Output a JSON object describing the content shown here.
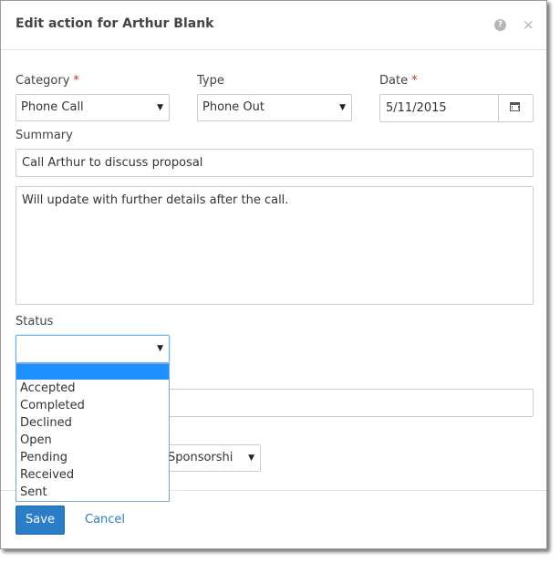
{
  "dialog": {
    "title": "Edit action for Arthur Blank",
    "help_icon_glyph": "?",
    "close_icon_glyph": "×"
  },
  "form": {
    "category": {
      "label": "Category",
      "required_mark": "*",
      "value": "Phone Call"
    },
    "type": {
      "label": "Type",
      "value": "Phone Out"
    },
    "date": {
      "label": "Date",
      "required_mark": "*",
      "value": "5/11/2015",
      "icon": "calendar-icon"
    },
    "summary": {
      "label": "Summary",
      "value": "Call Arthur to discuss proposal"
    },
    "notes": {
      "value": "Will update with further details after the call."
    },
    "status": {
      "label": "Status",
      "value": "",
      "options": [
        "",
        "Accepted",
        "Completed",
        "Declined",
        "Open",
        "Pending",
        "Received",
        "Sent"
      ],
      "highlighted_index": 0
    },
    "hidden_select": {
      "partial_value": "Sponsorshi"
    }
  },
  "footer": {
    "save_label": "Save",
    "cancel_label": "Cancel"
  },
  "colors": {
    "primary": "#2a7dc6",
    "required": "#c9302c",
    "highlight": "#1e90ff"
  }
}
